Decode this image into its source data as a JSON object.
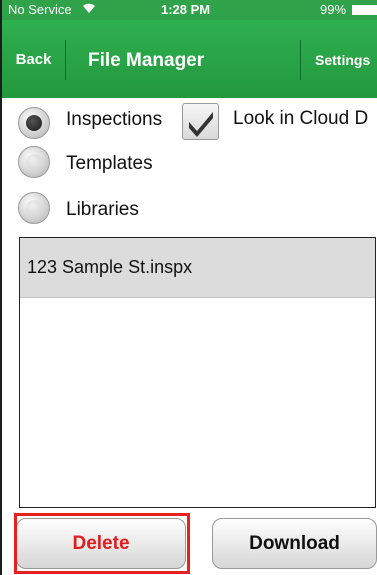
{
  "status_bar": {
    "carrier": "No Service",
    "wifi_icon": "wifi-icon",
    "time": "1:28 PM",
    "battery_percent": "99%",
    "battery_icon": "battery-icon"
  },
  "nav": {
    "back_label": "Back",
    "title": "File Manager",
    "settings_label": "Settings"
  },
  "options": {
    "inspections": {
      "label": "Inspections",
      "selected": true
    },
    "templates": {
      "label": "Templates",
      "selected": false
    },
    "libraries": {
      "label": "Libraries",
      "selected": false
    },
    "look_in_cloud": {
      "label": "Look in Cloud D",
      "checked": true
    }
  },
  "files": [
    {
      "name": "123 Sample St.inspx"
    }
  ],
  "actions": {
    "delete_label": "Delete",
    "download_label": "Download"
  },
  "colors": {
    "nav_green": "#2fa24a",
    "delete_red": "#e11c1c",
    "highlight_red": "#e8201f"
  }
}
